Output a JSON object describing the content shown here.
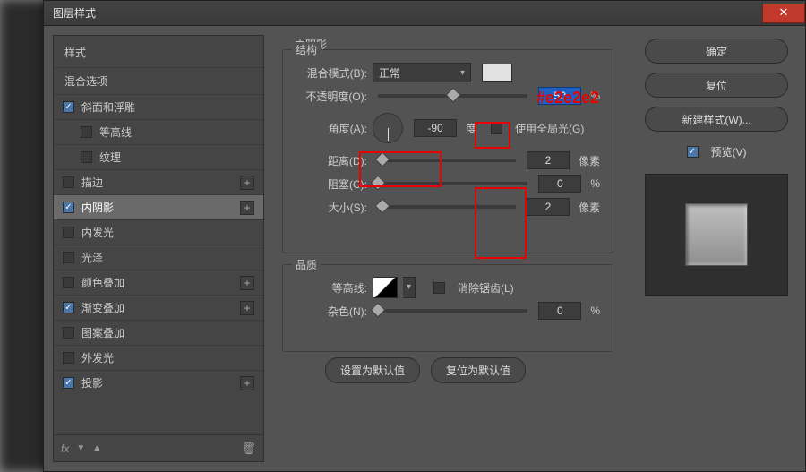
{
  "window": {
    "title": "图层样式"
  },
  "sidebar": {
    "header": "样式",
    "blend_header": "混合选项",
    "items": [
      {
        "label": "斜面和浮雕",
        "checked": true,
        "plus": false
      },
      {
        "label": "等高线",
        "checked": false,
        "plus": false,
        "child": true
      },
      {
        "label": "纹理",
        "checked": false,
        "plus": false,
        "child": true
      },
      {
        "label": "描边",
        "checked": false,
        "plus": true
      },
      {
        "label": "内阴影",
        "checked": true,
        "plus": true,
        "selected": true
      },
      {
        "label": "内发光",
        "checked": false,
        "plus": false
      },
      {
        "label": "光泽",
        "checked": false,
        "plus": false
      },
      {
        "label": "颜色叠加",
        "checked": false,
        "plus": true
      },
      {
        "label": "渐变叠加",
        "checked": true,
        "plus": true
      },
      {
        "label": "图案叠加",
        "checked": false,
        "plus": false
      },
      {
        "label": "外发光",
        "checked": false,
        "plus": false
      },
      {
        "label": "投影",
        "checked": true,
        "plus": true
      }
    ],
    "footer_fx": "fx"
  },
  "main": {
    "title": "内阴影",
    "struct_legend": "结构",
    "quality_legend": "品质",
    "blend_mode_label": "混合模式(B):",
    "blend_mode_value": "正常",
    "swatch_color": "#e2e2e2",
    "opacity_label": "不透明度(O):",
    "opacity_value": "50",
    "opacity_unit": "%",
    "angle_label": "角度(A):",
    "angle_value": "-90",
    "angle_unit": "度",
    "global_light_label": "使用全局光(G)",
    "global_light_checked": false,
    "distance_label": "距离(D):",
    "distance_value": "2",
    "distance_unit": "像素",
    "choke_label": "阻塞(C):",
    "choke_value": "0",
    "choke_unit": "%",
    "size_label": "大小(S):",
    "size_value": "2",
    "size_unit": "像素",
    "contour_label": "等高线:",
    "antialias_label": "消除锯齿(L)",
    "noise_label": "杂色(N):",
    "noise_value": "0",
    "noise_unit": "%",
    "reset_default": "设置为默认值",
    "restore_default": "复位为默认值"
  },
  "right": {
    "ok": "确定",
    "cancel": "复位",
    "new_style": "新建样式(W)...",
    "preview_label": "预览(V)",
    "preview_checked": true
  },
  "annotation": {
    "hex": "#e2e2e2"
  }
}
